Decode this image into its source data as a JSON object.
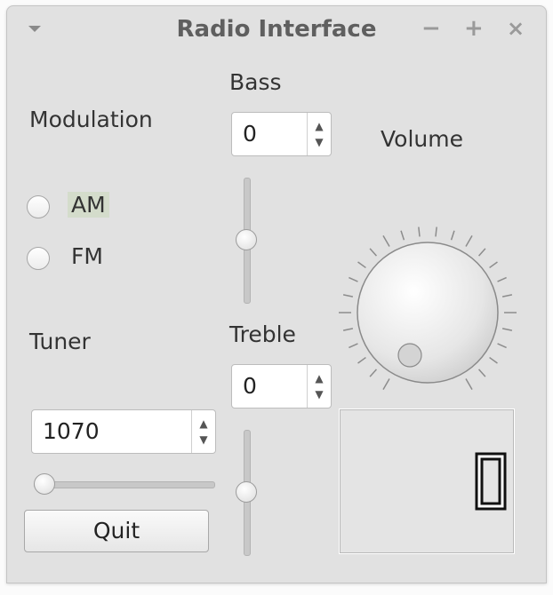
{
  "window": {
    "title": "Radio Interface",
    "controls": {
      "minimize": "−",
      "maximize": "+",
      "close": "×"
    }
  },
  "modulation": {
    "label": "Modulation",
    "options": [
      "AM",
      "FM"
    ],
    "focused": "AM",
    "selected": null
  },
  "bass": {
    "label": "Bass",
    "value": "0",
    "slider_level": 0.5
  },
  "treble": {
    "label": "Treble",
    "value": "0",
    "slider_level": 0.5
  },
  "volume": {
    "label": "Volume",
    "dial_value": 0
  },
  "tuner": {
    "label": "Tuner",
    "value": "1070",
    "slider_level": 0.0
  },
  "quit_button": "Quit",
  "lcd": {
    "value": "0"
  },
  "colors": {
    "window_bg": "#e1e1e1",
    "focus_highlight": "#d4dccb",
    "lcd_digit": "#111111"
  }
}
